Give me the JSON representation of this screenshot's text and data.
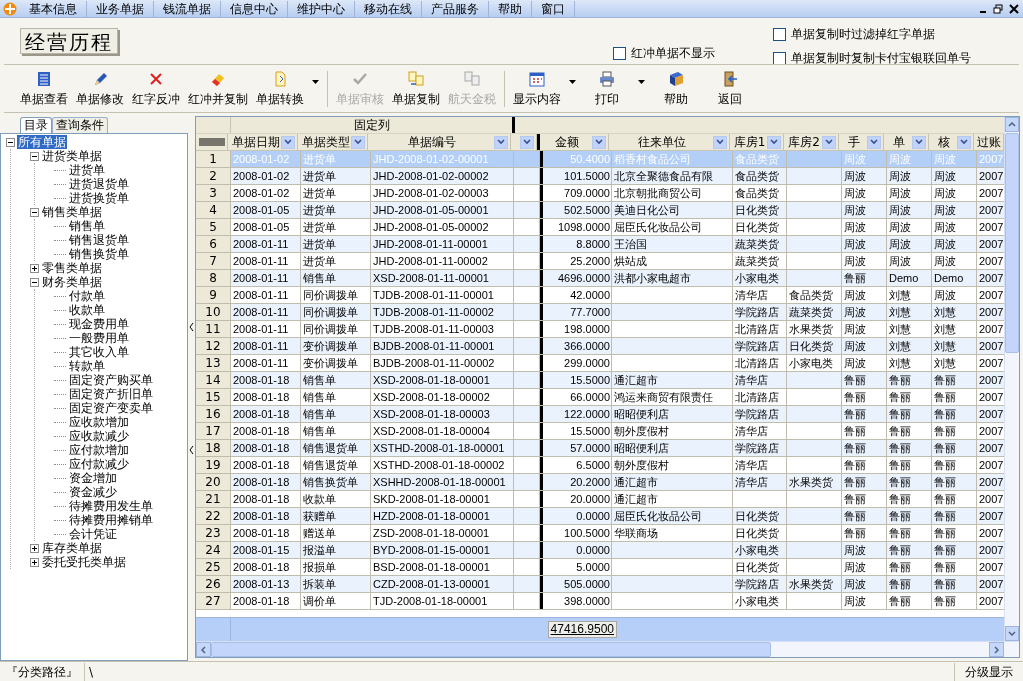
{
  "menu": [
    {
      "label": "基本信息"
    },
    {
      "label": "业务单据"
    },
    {
      "label": "钱流单据"
    },
    {
      "label": "信息中心"
    },
    {
      "label": "维护中心"
    },
    {
      "label": "移动在线"
    },
    {
      "label": "产品服务"
    },
    {
      "label": "帮助"
    },
    {
      "label": "窗口"
    }
  ],
  "title": "经营历程",
  "options": [
    {
      "label": "红冲单据不显示",
      "checked": false
    },
    {
      "label": "单据复制时过滤掉红字单据",
      "checked": false
    },
    {
      "label": "单据复制时复制卡付宝银联回单号",
      "checked": false
    }
  ],
  "toolbar": [
    {
      "label": "单据查看",
      "kind": "view",
      "disabled": false,
      "dropdown": false
    },
    {
      "label": "单据修改",
      "kind": "edit",
      "disabled": false,
      "dropdown": false
    },
    {
      "label": "红字反冲",
      "kind": "reverse",
      "disabled": false,
      "dropdown": false
    },
    {
      "label": "红冲并复制",
      "kind": "reversecopy",
      "disabled": false,
      "dropdown": false
    },
    {
      "label": "单据转换",
      "kind": "convert",
      "disabled": false,
      "dropdown": true
    },
    {
      "label": "单据审核",
      "kind": "audit",
      "disabled": true,
      "dropdown": false
    },
    {
      "label": "单据复制",
      "kind": "copy",
      "disabled": false,
      "dropdown": false
    },
    {
      "label": "航天金税",
      "kind": "tax",
      "disabled": true,
      "dropdown": false
    },
    {
      "label": "显示内容",
      "kind": "display",
      "disabled": false,
      "dropdown": true
    },
    {
      "label": "打印",
      "kind": "print",
      "disabled": false,
      "dropdown": true
    },
    {
      "label": "帮助",
      "kind": "help",
      "disabled": false,
      "dropdown": false
    },
    {
      "label": "返回",
      "kind": "back",
      "disabled": false,
      "dropdown": false
    }
  ],
  "tabs": [
    {
      "label": "目录",
      "selected": true
    },
    {
      "label": "查询条件",
      "selected": false
    }
  ],
  "tree": [
    {
      "label": "所有单据",
      "selected": true,
      "expanded": true,
      "children": [
        {
          "label": "进货类单据",
          "selected": false,
          "expanded": true,
          "children": [
            {
              "label": "进货单",
              "selected": false
            },
            {
              "label": "进货退货单",
              "selected": false
            },
            {
              "label": "进货换货单",
              "selected": false
            }
          ]
        },
        {
          "label": "销售类单据",
          "selected": false,
          "expanded": true,
          "children": [
            {
              "label": "销售单",
              "selected": false
            },
            {
              "label": "销售退货单",
              "selected": false
            },
            {
              "label": "销售换货单",
              "selected": false
            }
          ]
        },
        {
          "label": "零售类单据",
          "selected": false,
          "expanded": false
        },
        {
          "label": "财务类单据",
          "selected": false,
          "expanded": true,
          "children": [
            {
              "label": "付款单",
              "selected": false
            },
            {
              "label": "收款单",
              "selected": false
            },
            {
              "label": "现金费用单",
              "selected": false
            },
            {
              "label": "一般费用单",
              "selected": false
            },
            {
              "label": "其它收入单",
              "selected": false
            },
            {
              "label": "转款单",
              "selected": false
            },
            {
              "label": "固定资产购买单",
              "selected": false
            },
            {
              "label": "固定资产折旧单",
              "selected": false
            },
            {
              "label": "固定资产变卖单",
              "selected": false
            },
            {
              "label": "应收款增加",
              "selected": false
            },
            {
              "label": "应收款减少",
              "selected": false
            },
            {
              "label": "应付款增加",
              "selected": false
            },
            {
              "label": "应付款减少",
              "selected": false
            },
            {
              "label": "资金增加",
              "selected": false
            },
            {
              "label": "资金减少",
              "selected": false
            },
            {
              "label": "待摊费用发生单",
              "selected": false
            },
            {
              "label": "待摊费用摊销单",
              "selected": false
            },
            {
              "label": "会计凭证",
              "selected": false
            }
          ]
        },
        {
          "label": "库存类单据",
          "selected": false,
          "expanded": false
        },
        {
          "label": "委托受托类单据",
          "selected": false,
          "expanded": false
        }
      ]
    }
  ],
  "grid": {
    "group_header": "固定列",
    "columns": [
      {
        "label": "单据日期",
        "filter": true
      },
      {
        "label": "单据类型",
        "filter": true
      },
      {
        "label": "单据编号",
        "filter": true
      },
      {
        "filter": true
      },
      {
        "label": "金额",
        "filter": true
      },
      {
        "label": "往来单位",
        "filter": true
      },
      {
        "label": "库房1",
        "filter": true
      },
      {
        "label": "库房2",
        "filter": true
      },
      {
        "label": "手",
        "filter": true
      },
      {
        "label": "单",
        "filter": true
      },
      {
        "label": "核",
        "filter": true
      },
      {
        "label": "过账",
        "filter": false
      }
    ],
    "rows": [
      {
        "no": "1",
        "selected": true,
        "date": "2008-01-02",
        "type": "进货单",
        "number": "JHD-2008-01-02-00001",
        "amount": "50.4000",
        "partner": "稻香村食品公司",
        "store1": "食品类货",
        "handler": "周波",
        "maker": "周波",
        "auditor": "周波",
        "posted": "2007"
      },
      {
        "no": "2",
        "selected": false,
        "date": "2008-01-02",
        "type": "进货单",
        "number": "JHD-2008-01-02-00002",
        "amount": "101.5000",
        "partner": "北京全聚德食品有限",
        "store1": "食品类货",
        "handler": "周波",
        "maker": "周波",
        "auditor": "周波",
        "posted": "2007"
      },
      {
        "no": "3",
        "selected": false,
        "date": "2008-01-02",
        "type": "进货单",
        "number": "JHD-2008-01-02-00003",
        "amount": "709.0000",
        "partner": "北京朝批商贸公司",
        "store1": "食品类货",
        "handler": "周波",
        "maker": "周波",
        "auditor": "周波",
        "posted": "2007"
      },
      {
        "no": "4",
        "selected": false,
        "date": "2008-01-05",
        "type": "进货单",
        "number": "JHD-2008-01-05-00001",
        "amount": "502.5000",
        "partner": "美迪日化公司",
        "store1": "日化类货",
        "handler": "周波",
        "maker": "周波",
        "auditor": "周波",
        "posted": "2007"
      },
      {
        "no": "5",
        "selected": false,
        "date": "2008-01-05",
        "type": "进货单",
        "number": "JHD-2008-01-05-00002",
        "amount": "1098.0000",
        "partner": "屈臣氏化妆品公司",
        "store1": "日化类货",
        "handler": "周波",
        "maker": "周波",
        "auditor": "周波",
        "posted": "2007"
      },
      {
        "no": "6",
        "selected": false,
        "date": "2008-01-11",
        "type": "进货单",
        "number": "JHD-2008-01-11-00001",
        "amount": "8.8000",
        "partner": "王治国",
        "store1": "蔬菜类货",
        "handler": "周波",
        "maker": "周波",
        "auditor": "周波",
        "posted": "2007"
      },
      {
        "no": "7",
        "selected": false,
        "date": "2008-01-11",
        "type": "进货单",
        "number": "JHD-2008-01-11-00002",
        "amount": "25.2000",
        "partner": "烘站成",
        "store1": "蔬菜类货",
        "handler": "周波",
        "maker": "周波",
        "auditor": "周波",
        "posted": "2007"
      },
      {
        "no": "8",
        "selected": false,
        "date": "2008-01-11",
        "type": "销售单",
        "number": "XSD-2008-01-11-00001",
        "amount": "4696.0000",
        "partner": "洪都小家电超市",
        "store1": "小家电类",
        "handler": "鲁丽",
        "maker": "Demo",
        "auditor": "Demo",
        "posted": "2007"
      },
      {
        "no": "9",
        "selected": false,
        "date": "2008-01-11",
        "type": "同价调拨单",
        "number": "TJDB-2008-01-11-00001",
        "amount": "42.0000",
        "store1": "清华店",
        "store2": "食品类货",
        "handler": "周波",
        "maker": "刘慧",
        "auditor": "周波",
        "posted": "2007"
      },
      {
        "no": "10",
        "selected": false,
        "date": "2008-01-11",
        "type": "同价调拨单",
        "number": "TJDB-2008-01-11-00002",
        "amount": "77.7000",
        "store1": "学院路店",
        "store2": "蔬菜类货",
        "handler": "周波",
        "maker": "刘慧",
        "auditor": "刘慧",
        "posted": "2007"
      },
      {
        "no": "11",
        "selected": false,
        "date": "2008-01-11",
        "type": "同价调拨单",
        "number": "TJDB-2008-01-11-00003",
        "amount": "198.0000",
        "store1": "北清路店",
        "store2": "水果类货",
        "handler": "周波",
        "maker": "刘慧",
        "auditor": "刘慧",
        "posted": "2007"
      },
      {
        "no": "12",
        "selected": false,
        "date": "2008-01-11",
        "type": "变价调拨单",
        "number": "BJDB-2008-01-11-00001",
        "amount": "366.0000",
        "store1": "学院路店",
        "store2": "日化类货",
        "handler": "周波",
        "maker": "刘慧",
        "auditor": "刘慧",
        "posted": "2007"
      },
      {
        "no": "13",
        "selected": false,
        "date": "2008-01-11",
        "type": "变价调拨单",
        "number": "BJDB-2008-01-11-00002",
        "amount": "299.0000",
        "store1": "北清路店",
        "store2": "小家电类",
        "handler": "周波",
        "maker": "刘慧",
        "auditor": "刘慧",
        "posted": "2007"
      },
      {
        "no": "14",
        "selected": false,
        "date": "2008-01-18",
        "type": "销售单",
        "number": "XSD-2008-01-18-00001",
        "amount": "15.5000",
        "partner": "通汇超市",
        "store1": "清华店",
        "handler": "鲁丽",
        "maker": "鲁丽",
        "auditor": "鲁丽",
        "posted": "2007"
      },
      {
        "no": "15",
        "selected": false,
        "date": "2008-01-18",
        "type": "销售单",
        "number": "XSD-2008-01-18-00002",
        "amount": "66.0000",
        "partner": "鸿运来商贸有限责任",
        "store1": "北清路店",
        "handler": "鲁丽",
        "maker": "鲁丽",
        "auditor": "鲁丽",
        "posted": "2007"
      },
      {
        "no": "16",
        "selected": false,
        "date": "2008-01-18",
        "type": "销售单",
        "number": "XSD-2008-01-18-00003",
        "amount": "122.0000",
        "partner": "昭昭便利店",
        "store1": "学院路店",
        "handler": "鲁丽",
        "maker": "鲁丽",
        "auditor": "鲁丽",
        "posted": "2007"
      },
      {
        "no": "17",
        "selected": false,
        "date": "2008-01-18",
        "type": "销售单",
        "number": "XSD-2008-01-18-00004",
        "amount": "15.5000",
        "partner": "朝外度假村",
        "store1": "清华店",
        "handler": "鲁丽",
        "maker": "鲁丽",
        "auditor": "鲁丽",
        "posted": "2007"
      },
      {
        "no": "18",
        "selected": false,
        "date": "2008-01-18",
        "type": "销售退货单",
        "number": "XSTHD-2008-01-18-00001",
        "amount": "57.0000",
        "partner": "昭昭便利店",
        "store1": "学院路店",
        "handler": "鲁丽",
        "maker": "鲁丽",
        "auditor": "鲁丽",
        "posted": "2007"
      },
      {
        "no": "19",
        "selected": false,
        "date": "2008-01-18",
        "type": "销售退货单",
        "number": "XSTHD-2008-01-18-00002",
        "amount": "6.5000",
        "partner": "朝外度假村",
        "store1": "清华店",
        "handler": "鲁丽",
        "maker": "鲁丽",
        "auditor": "鲁丽",
        "posted": "2007"
      },
      {
        "no": "20",
        "selected": false,
        "date": "2008-01-18",
        "type": "销售换货单",
        "number": "XSHHD-2008-01-18-00001",
        "amount": "20.2000",
        "partner": "通汇超市",
        "store1": "清华店",
        "store2": "水果类货",
        "handler": "鲁丽",
        "maker": "鲁丽",
        "auditor": "鲁丽",
        "posted": "2007"
      },
      {
        "no": "21",
        "selected": false,
        "date": "2008-01-18",
        "type": "收款单",
        "number": "SKD-2008-01-18-00001",
        "amount": "20.0000",
        "partner": "通汇超市",
        "handler": "鲁丽",
        "maker": "鲁丽",
        "auditor": "鲁丽",
        "posted": "2007"
      },
      {
        "no": "22",
        "selected": false,
        "date": "2008-01-18",
        "type": "获赠单",
        "number": "HZD-2008-01-18-00001",
        "amount": "0.0000",
        "partner": "屈臣氏化妆品公司",
        "store1": "日化类货",
        "handler": "鲁丽",
        "maker": "鲁丽",
        "auditor": "鲁丽",
        "posted": "2007"
      },
      {
        "no": "23",
        "selected": false,
        "date": "2008-01-18",
        "type": "赠送单",
        "number": "ZSD-2008-01-18-00001",
        "amount": "100.5000",
        "partner": "华联商场",
        "store1": "日化类货",
        "handler": "鲁丽",
        "maker": "鲁丽",
        "auditor": "鲁丽",
        "posted": "2007"
      },
      {
        "no": "24",
        "selected": false,
        "date": "2008-01-15",
        "type": "报溢单",
        "number": "BYD-2008-01-15-00001",
        "amount": "0.0000",
        "store1": "小家电类",
        "handler": "周波",
        "maker": "鲁丽",
        "auditor": "鲁丽",
        "posted": "2007"
      },
      {
        "no": "25",
        "selected": false,
        "date": "2008-01-18",
        "type": "报损单",
        "number": "BSD-2008-01-18-00001",
        "amount": "5.0000",
        "store1": "日化类货",
        "handler": "周波",
        "maker": "鲁丽",
        "auditor": "鲁丽",
        "posted": "2007"
      },
      {
        "no": "26",
        "selected": false,
        "date": "2008-01-13",
        "type": "拆装单",
        "number": "CZD-2008-01-13-00001",
        "amount": "505.0000",
        "store1": "学院路店",
        "store2": "水果类货",
        "handler": "周波",
        "maker": "鲁丽",
        "auditor": "鲁丽",
        "posted": "2007"
      },
      {
        "no": "27",
        "selected": false,
        "date": "2008-01-18",
        "type": "调价单",
        "number": "TJD-2008-01-18-00001",
        "amount": "398.0000",
        "store1": "小家电类",
        "handler": "周波",
        "maker": "鲁丽",
        "auditor": "鲁丽",
        "posted": "2007"
      }
    ],
    "total": "47416.9500"
  },
  "status_bar": {
    "path_label": "『分类路径』",
    "path": "\\",
    "mode": "分级显示"
  }
}
